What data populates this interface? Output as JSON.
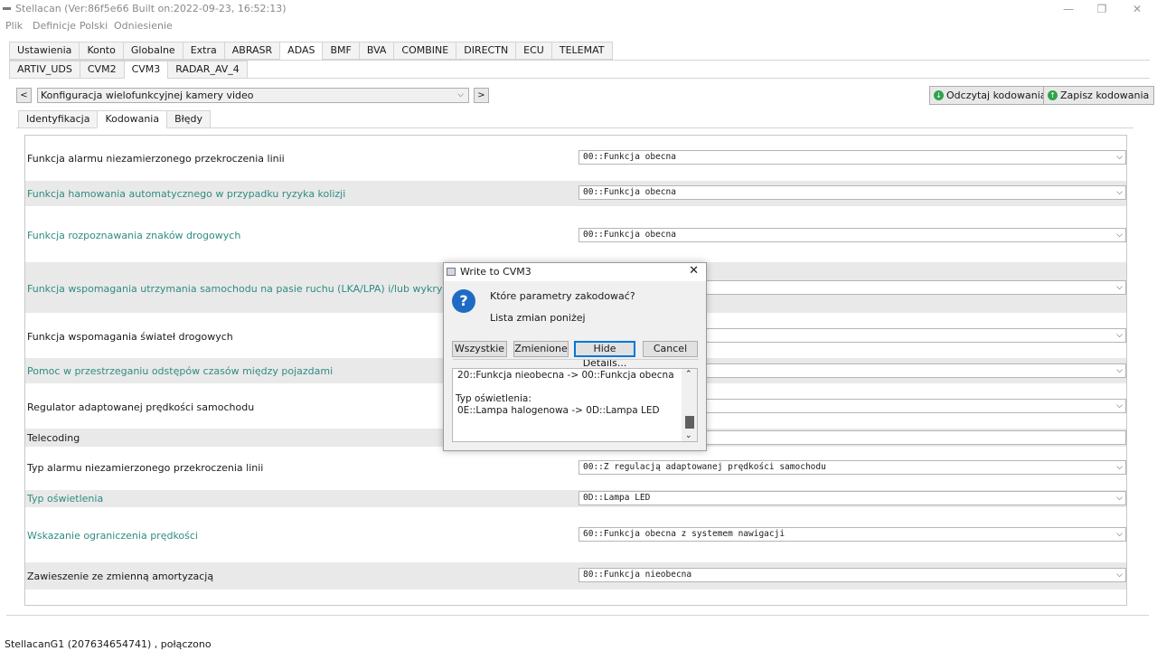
{
  "window": {
    "title": "Stellacan (Ver:86f5e66 Built on:2022-09-23, 16:52:13)"
  },
  "menu": [
    "Plik",
    "Definicje",
    "Polski",
    "Odniesienie"
  ],
  "main_tabs": [
    {
      "label": "Ustawienia",
      "active": false
    },
    {
      "label": "Konto",
      "active": false
    },
    {
      "label": "Globalne",
      "active": false
    },
    {
      "label": "Extra",
      "active": false
    },
    {
      "label": "ABRASR",
      "active": false
    },
    {
      "label": "ADAS",
      "active": true
    },
    {
      "label": "BMF",
      "active": false
    },
    {
      "label": "BVA",
      "active": false
    },
    {
      "label": "COMBINE",
      "active": false
    },
    {
      "label": "DIRECTN",
      "active": false
    },
    {
      "label": "ECU",
      "active": false
    },
    {
      "label": "TELEMAT",
      "active": false
    }
  ],
  "sub_tabs": [
    {
      "label": "ARTIV_UDS",
      "active": false
    },
    {
      "label": "CVM2",
      "active": false
    },
    {
      "label": "CVM3",
      "active": true
    },
    {
      "label": "RADAR_AV_4",
      "active": false
    }
  ],
  "toolbar": {
    "prev": "<",
    "next": ">",
    "module_select": "Konfiguracja wielofunkcyjnej kamery video",
    "read_button": "Odczytaj kodowania",
    "write_button": "Zapisz kodowania"
  },
  "section_tabs": [
    {
      "label": "Identyfikacja",
      "active": false
    },
    {
      "label": "Kodowania",
      "active": true
    },
    {
      "label": "Błędy",
      "active": false
    }
  ],
  "rows": [
    {
      "label": "Funkcja alarmu niezamierzonego przekroczenia linii",
      "value": "00::Funkcja obecna",
      "changed": false
    },
    {
      "label": "Funkcja hamowania automatycznego w przypadku ryzyka kolizji",
      "value": "00::Funkcja obecna",
      "changed": true
    },
    {
      "label": "Funkcja rozpoznawania znaków drogowych",
      "value": "00::Funkcja obecna",
      "changed": true
    },
    {
      "label": "Funkcja wspomagania utrzymania samochodu na pasie ruchu (LKA/LPA) i/lub wykrycie spadku czujności k",
      "value": "",
      "changed": true
    },
    {
      "label": "Funkcja wspomagania świateł drogowych",
      "value": "",
      "changed": false
    },
    {
      "label": "Pomoc w przestrzeganiu odstępów czasów między pojazdami",
      "value": "",
      "changed": true
    },
    {
      "label": "Regulator adaptowanej prędkości samochodu",
      "value": "",
      "changed": false
    },
    {
      "label": "Telecoding",
      "value": "",
      "changed": false
    },
    {
      "label": "Typ alarmu niezamierzonego przekroczenia linii",
      "value": "00::Z regulacją adaptowanej prędkości samochodu",
      "changed": false
    },
    {
      "label": "Typ oświetlenia",
      "value": "0D::Lampa LED",
      "changed": true
    },
    {
      "label": "Wskazanie ograniczenia prędkości",
      "value": "60::Funkcja obecna z systemem nawigacji",
      "changed": true
    },
    {
      "label": "Zawieszenie ze zmienną amortyzacją",
      "value": "80::Funkcja nieobecna",
      "changed": false
    }
  ],
  "dialog": {
    "title": "Write to CVM3",
    "question": "Które parametry zakodować?",
    "subtitle": "Lista zmian poniżej",
    "buttons": {
      "all": "Wszystkie",
      "changed": "Zmienione",
      "details": "Hide Details...",
      "cancel": "Cancel"
    },
    "details_lines": [
      "20::Funkcja nieobecna -> 00::Funkcja obecna",
      "",
      "Typ oświetlenia:",
      "0E::Lampa halogenowa -> 0D::Lampa LED"
    ]
  },
  "status": "StellacanG1 (207634654741) , połączono",
  "colors": {
    "changed_label": "#2f8c83",
    "accent": "#0078d7",
    "green_icon": "#2fa34a"
  }
}
